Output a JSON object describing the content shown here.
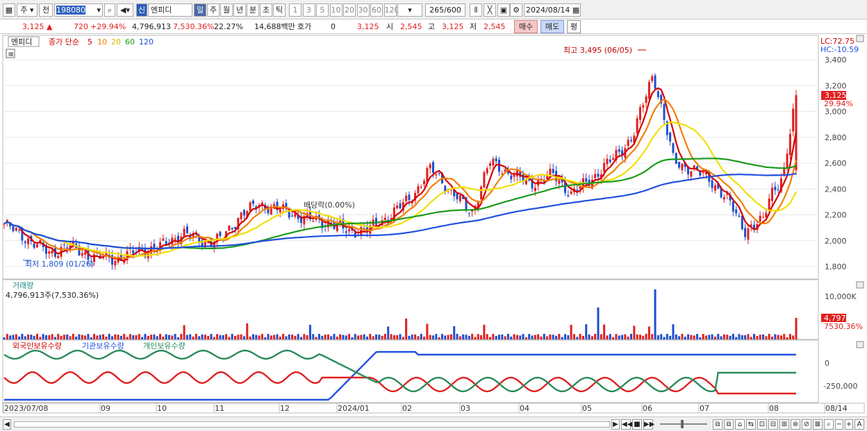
{
  "toolbar": {
    "market_select": "주",
    "prev_label": "전",
    "stock_code": "198080",
    "shin_label": "신",
    "stock_name": "엔피디",
    "periods": [
      "일",
      "주",
      "월",
      "년",
      "분",
      "초",
      "틱"
    ],
    "active_period": "일",
    "intervals": [
      "1",
      "3",
      "5",
      "10",
      "20",
      "30",
      "60",
      "120"
    ],
    "count_value": "265",
    "count_total": "/600",
    "date": "2024/08/14"
  },
  "infobar": {
    "price": "3,125",
    "change": "720",
    "change_pct": "+29.94%",
    "volume": "4,796,913",
    "volume_pct": "7,530.36%",
    "turnover": "22.27%",
    "amount": "14,688백만",
    "hoga_label": "호가",
    "hoga_value": "0",
    "hoga_price": "3,125",
    "open_label": "시",
    "open_value": "2,545",
    "high_label": "고",
    "high_value": "3,125",
    "low_label": "저",
    "low_value": "2,545",
    "buy_label": "매수",
    "sell_label": "매도",
    "pyeong_label": "평"
  },
  "price_panel": {
    "name_tag": "엔피디",
    "ma_title": "종가 단순",
    "ma_periods": [
      "5",
      "10",
      "20",
      "60",
      "120"
    ],
    "high_annotation": "최고 3,495 (06/05)",
    "low_annotation": "최저 1,809 (01/26)",
    "dividend_annotation": "배당락(0.00%)",
    "lc": "LC:72.75",
    "hc": "HC:-10.59",
    "y_ticks": [
      "3,400",
      "3,200",
      "3,000",
      "2,800",
      "2,600",
      "2,400",
      "2,200",
      "2,000",
      "1,800"
    ],
    "current_price_tag": "3,125",
    "current_pct_tag": "29.94%"
  },
  "volume_panel": {
    "title": "거래량",
    "value": "4,796,913주(7,530.36%)",
    "y_tick": "10,000K",
    "current_tag": "4,797K",
    "current_pct": "7530.36%"
  },
  "holdings_panel": {
    "legend": [
      "외국인보유수량",
      "기관보유수량",
      "개인보유수량"
    ],
    "y_ticks": [
      "0",
      "-250,000"
    ]
  },
  "x_labels": [
    "2023/07/08",
    "09",
    "10",
    "11",
    "12",
    "2024/01",
    "02",
    "03",
    "04",
    "05",
    "06",
    "07",
    "08",
    "08/14"
  ],
  "colors": {
    "up": "#e02020",
    "down": "#1f4fd0",
    "ma5": "#d40000",
    "ma10": "#f08000",
    "ma20": "#f0e000",
    "ma60": "#1a9a1a",
    "ma120": "#2050e0"
  },
  "chart_data": {
    "type": "candlestick",
    "title": "엔피디",
    "price_range": [
      1700,
      3500
    ],
    "annotations": [
      {
        "label": "최고",
        "value": 3495,
        "date": "06/05"
      },
      {
        "label": "최저",
        "value": 1809,
        "date": "01/26"
      }
    ],
    "last": {
      "close": 3125,
      "open": 2545,
      "high": 3125,
      "low": 2545,
      "volume": 4796913
    }
  }
}
